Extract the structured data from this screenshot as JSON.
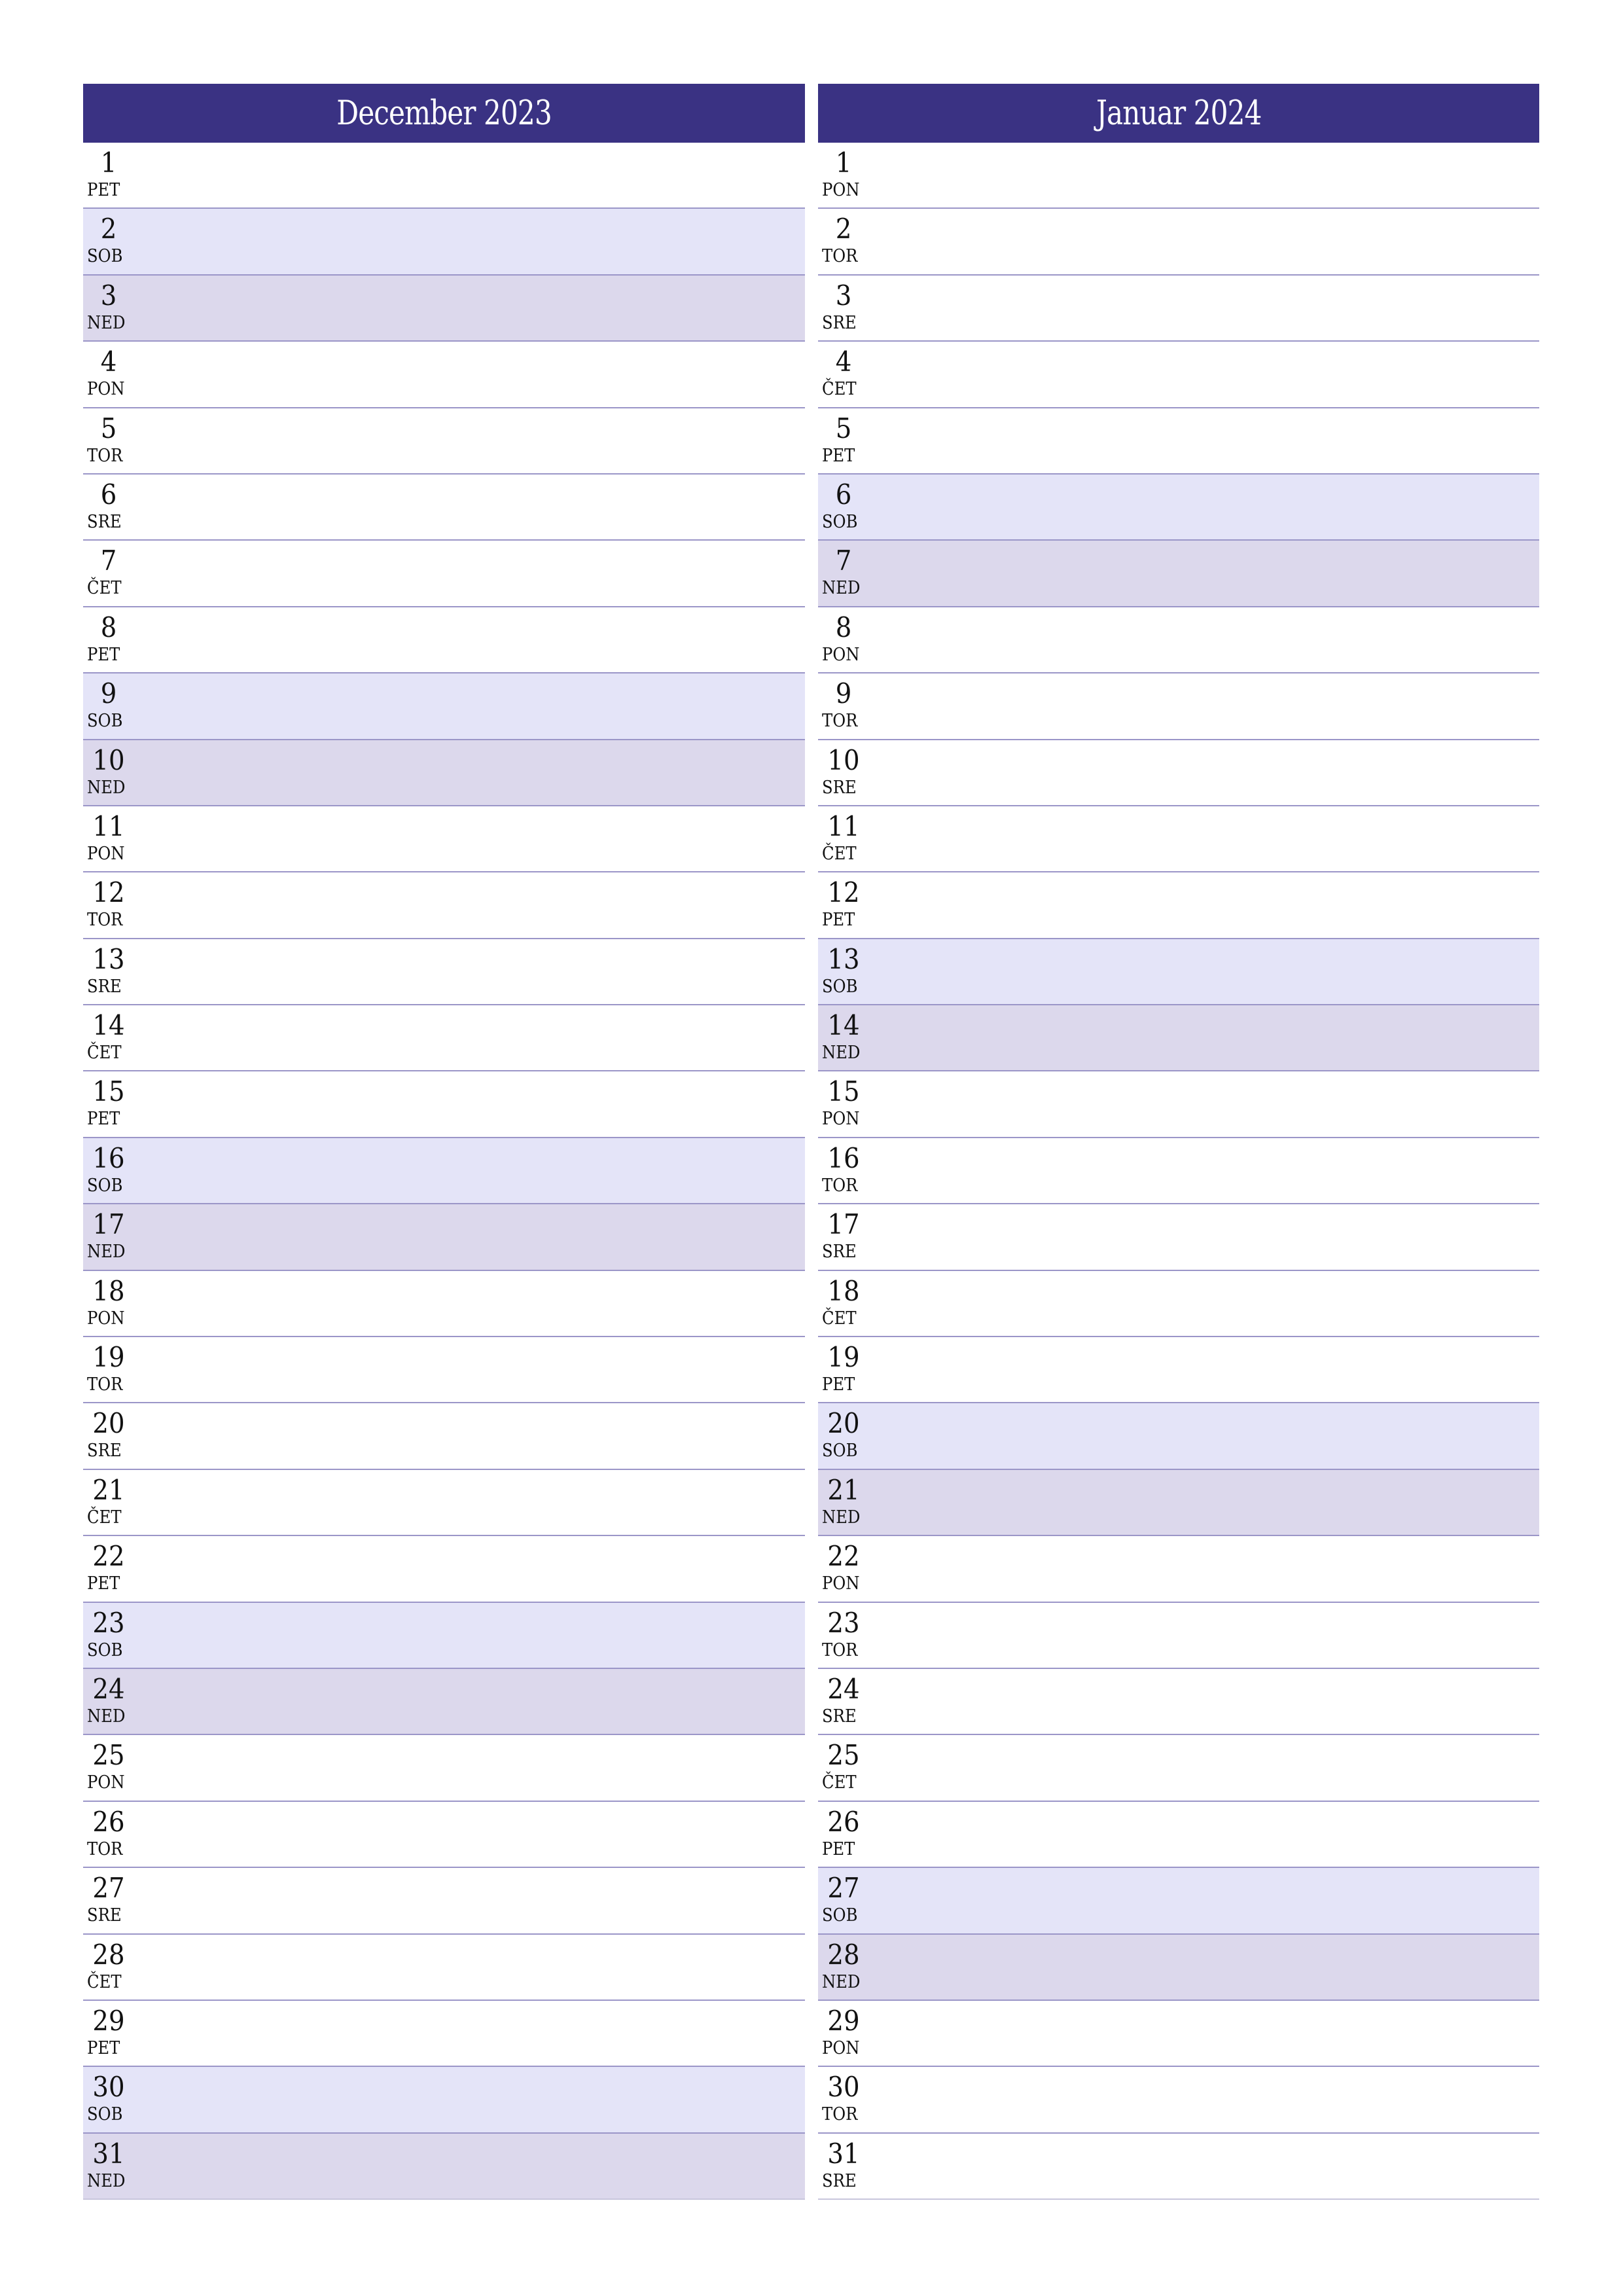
{
  "colors": {
    "header_bg": "#3a3283",
    "saturday_bg": "#e4e4f8",
    "sunday_bg": "#dcd8ec",
    "row_line": "#9b96c8"
  },
  "months": [
    {
      "title": "December 2023",
      "days": [
        {
          "num": "1",
          "name": "PET",
          "type": "weekday"
        },
        {
          "num": "2",
          "name": "SOB",
          "type": "sat"
        },
        {
          "num": "3",
          "name": "NED",
          "type": "sun"
        },
        {
          "num": "4",
          "name": "PON",
          "type": "weekday"
        },
        {
          "num": "5",
          "name": "TOR",
          "type": "weekday"
        },
        {
          "num": "6",
          "name": "SRE",
          "type": "weekday"
        },
        {
          "num": "7",
          "name": "ČET",
          "type": "weekday"
        },
        {
          "num": "8",
          "name": "PET",
          "type": "weekday"
        },
        {
          "num": "9",
          "name": "SOB",
          "type": "sat"
        },
        {
          "num": "10",
          "name": "NED",
          "type": "sun"
        },
        {
          "num": "11",
          "name": "PON",
          "type": "weekday"
        },
        {
          "num": "12",
          "name": "TOR",
          "type": "weekday"
        },
        {
          "num": "13",
          "name": "SRE",
          "type": "weekday"
        },
        {
          "num": "14",
          "name": "ČET",
          "type": "weekday"
        },
        {
          "num": "15",
          "name": "PET",
          "type": "weekday"
        },
        {
          "num": "16",
          "name": "SOB",
          "type": "sat"
        },
        {
          "num": "17",
          "name": "NED",
          "type": "sun"
        },
        {
          "num": "18",
          "name": "PON",
          "type": "weekday"
        },
        {
          "num": "19",
          "name": "TOR",
          "type": "weekday"
        },
        {
          "num": "20",
          "name": "SRE",
          "type": "weekday"
        },
        {
          "num": "21",
          "name": "ČET",
          "type": "weekday"
        },
        {
          "num": "22",
          "name": "PET",
          "type": "weekday"
        },
        {
          "num": "23",
          "name": "SOB",
          "type": "sat"
        },
        {
          "num": "24",
          "name": "NED",
          "type": "sun"
        },
        {
          "num": "25",
          "name": "PON",
          "type": "weekday"
        },
        {
          "num": "26",
          "name": "TOR",
          "type": "weekday"
        },
        {
          "num": "27",
          "name": "SRE",
          "type": "weekday"
        },
        {
          "num": "28",
          "name": "ČET",
          "type": "weekday"
        },
        {
          "num": "29",
          "name": "PET",
          "type": "weekday"
        },
        {
          "num": "30",
          "name": "SOB",
          "type": "sat"
        },
        {
          "num": "31",
          "name": "NED",
          "type": "sun"
        }
      ]
    },
    {
      "title": "Januar 2024",
      "days": [
        {
          "num": "1",
          "name": "PON",
          "type": "weekday"
        },
        {
          "num": "2",
          "name": "TOR",
          "type": "weekday"
        },
        {
          "num": "3",
          "name": "SRE",
          "type": "weekday"
        },
        {
          "num": "4",
          "name": "ČET",
          "type": "weekday"
        },
        {
          "num": "5",
          "name": "PET",
          "type": "weekday"
        },
        {
          "num": "6",
          "name": "SOB",
          "type": "sat"
        },
        {
          "num": "7",
          "name": "NED",
          "type": "sun"
        },
        {
          "num": "8",
          "name": "PON",
          "type": "weekday"
        },
        {
          "num": "9",
          "name": "TOR",
          "type": "weekday"
        },
        {
          "num": "10",
          "name": "SRE",
          "type": "weekday"
        },
        {
          "num": "11",
          "name": "ČET",
          "type": "weekday"
        },
        {
          "num": "12",
          "name": "PET",
          "type": "weekday"
        },
        {
          "num": "13",
          "name": "SOB",
          "type": "sat"
        },
        {
          "num": "14",
          "name": "NED",
          "type": "sun"
        },
        {
          "num": "15",
          "name": "PON",
          "type": "weekday"
        },
        {
          "num": "16",
          "name": "TOR",
          "type": "weekday"
        },
        {
          "num": "17",
          "name": "SRE",
          "type": "weekday"
        },
        {
          "num": "18",
          "name": "ČET",
          "type": "weekday"
        },
        {
          "num": "19",
          "name": "PET",
          "type": "weekday"
        },
        {
          "num": "20",
          "name": "SOB",
          "type": "sat"
        },
        {
          "num": "21",
          "name": "NED",
          "type": "sun"
        },
        {
          "num": "22",
          "name": "PON",
          "type": "weekday"
        },
        {
          "num": "23",
          "name": "TOR",
          "type": "weekday"
        },
        {
          "num": "24",
          "name": "SRE",
          "type": "weekday"
        },
        {
          "num": "25",
          "name": "ČET",
          "type": "weekday"
        },
        {
          "num": "26",
          "name": "PET",
          "type": "weekday"
        },
        {
          "num": "27",
          "name": "SOB",
          "type": "sat"
        },
        {
          "num": "28",
          "name": "NED",
          "type": "sun"
        },
        {
          "num": "29",
          "name": "PON",
          "type": "weekday"
        },
        {
          "num": "30",
          "name": "TOR",
          "type": "weekday"
        },
        {
          "num": "31",
          "name": "SRE",
          "type": "weekday"
        }
      ]
    }
  ]
}
